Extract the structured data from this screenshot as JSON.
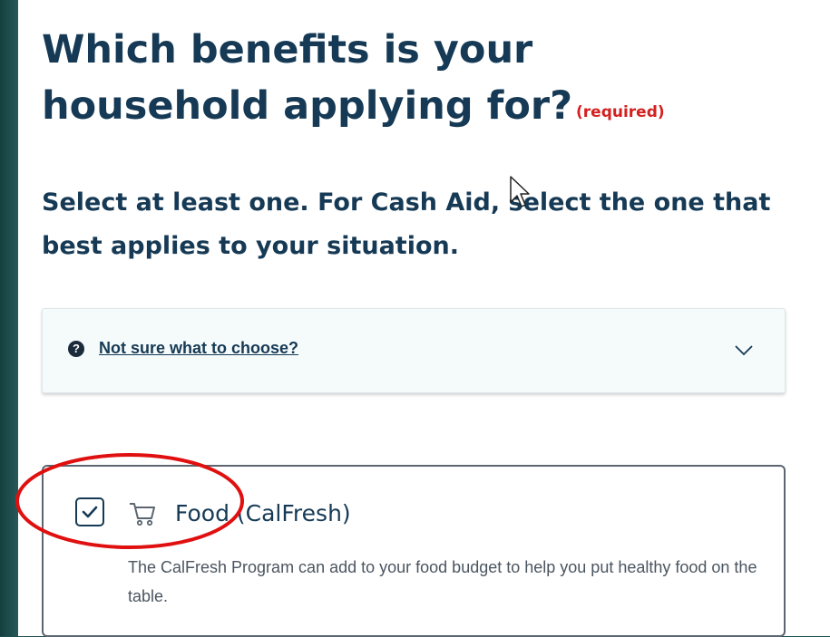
{
  "page": {
    "title": "Which benefits is your household applying for?",
    "required_label": "(required)",
    "subtitle": "Select at least one. For Cash Aid, select the one that best applies to your situation."
  },
  "help": {
    "icon": "question-circle-icon",
    "link_text": "Not sure what to choose?",
    "expanded": false
  },
  "options": [
    {
      "label": "Food (CalFresh)",
      "icon": "cart-icon",
      "checked": true,
      "description": "The CalFresh Program can add to your food budget to help you put healthy food on the table."
    }
  ],
  "colors": {
    "heading": "#163a55",
    "required": "#d42020",
    "annotation": "#e01010",
    "background": "#1f4f4f"
  }
}
